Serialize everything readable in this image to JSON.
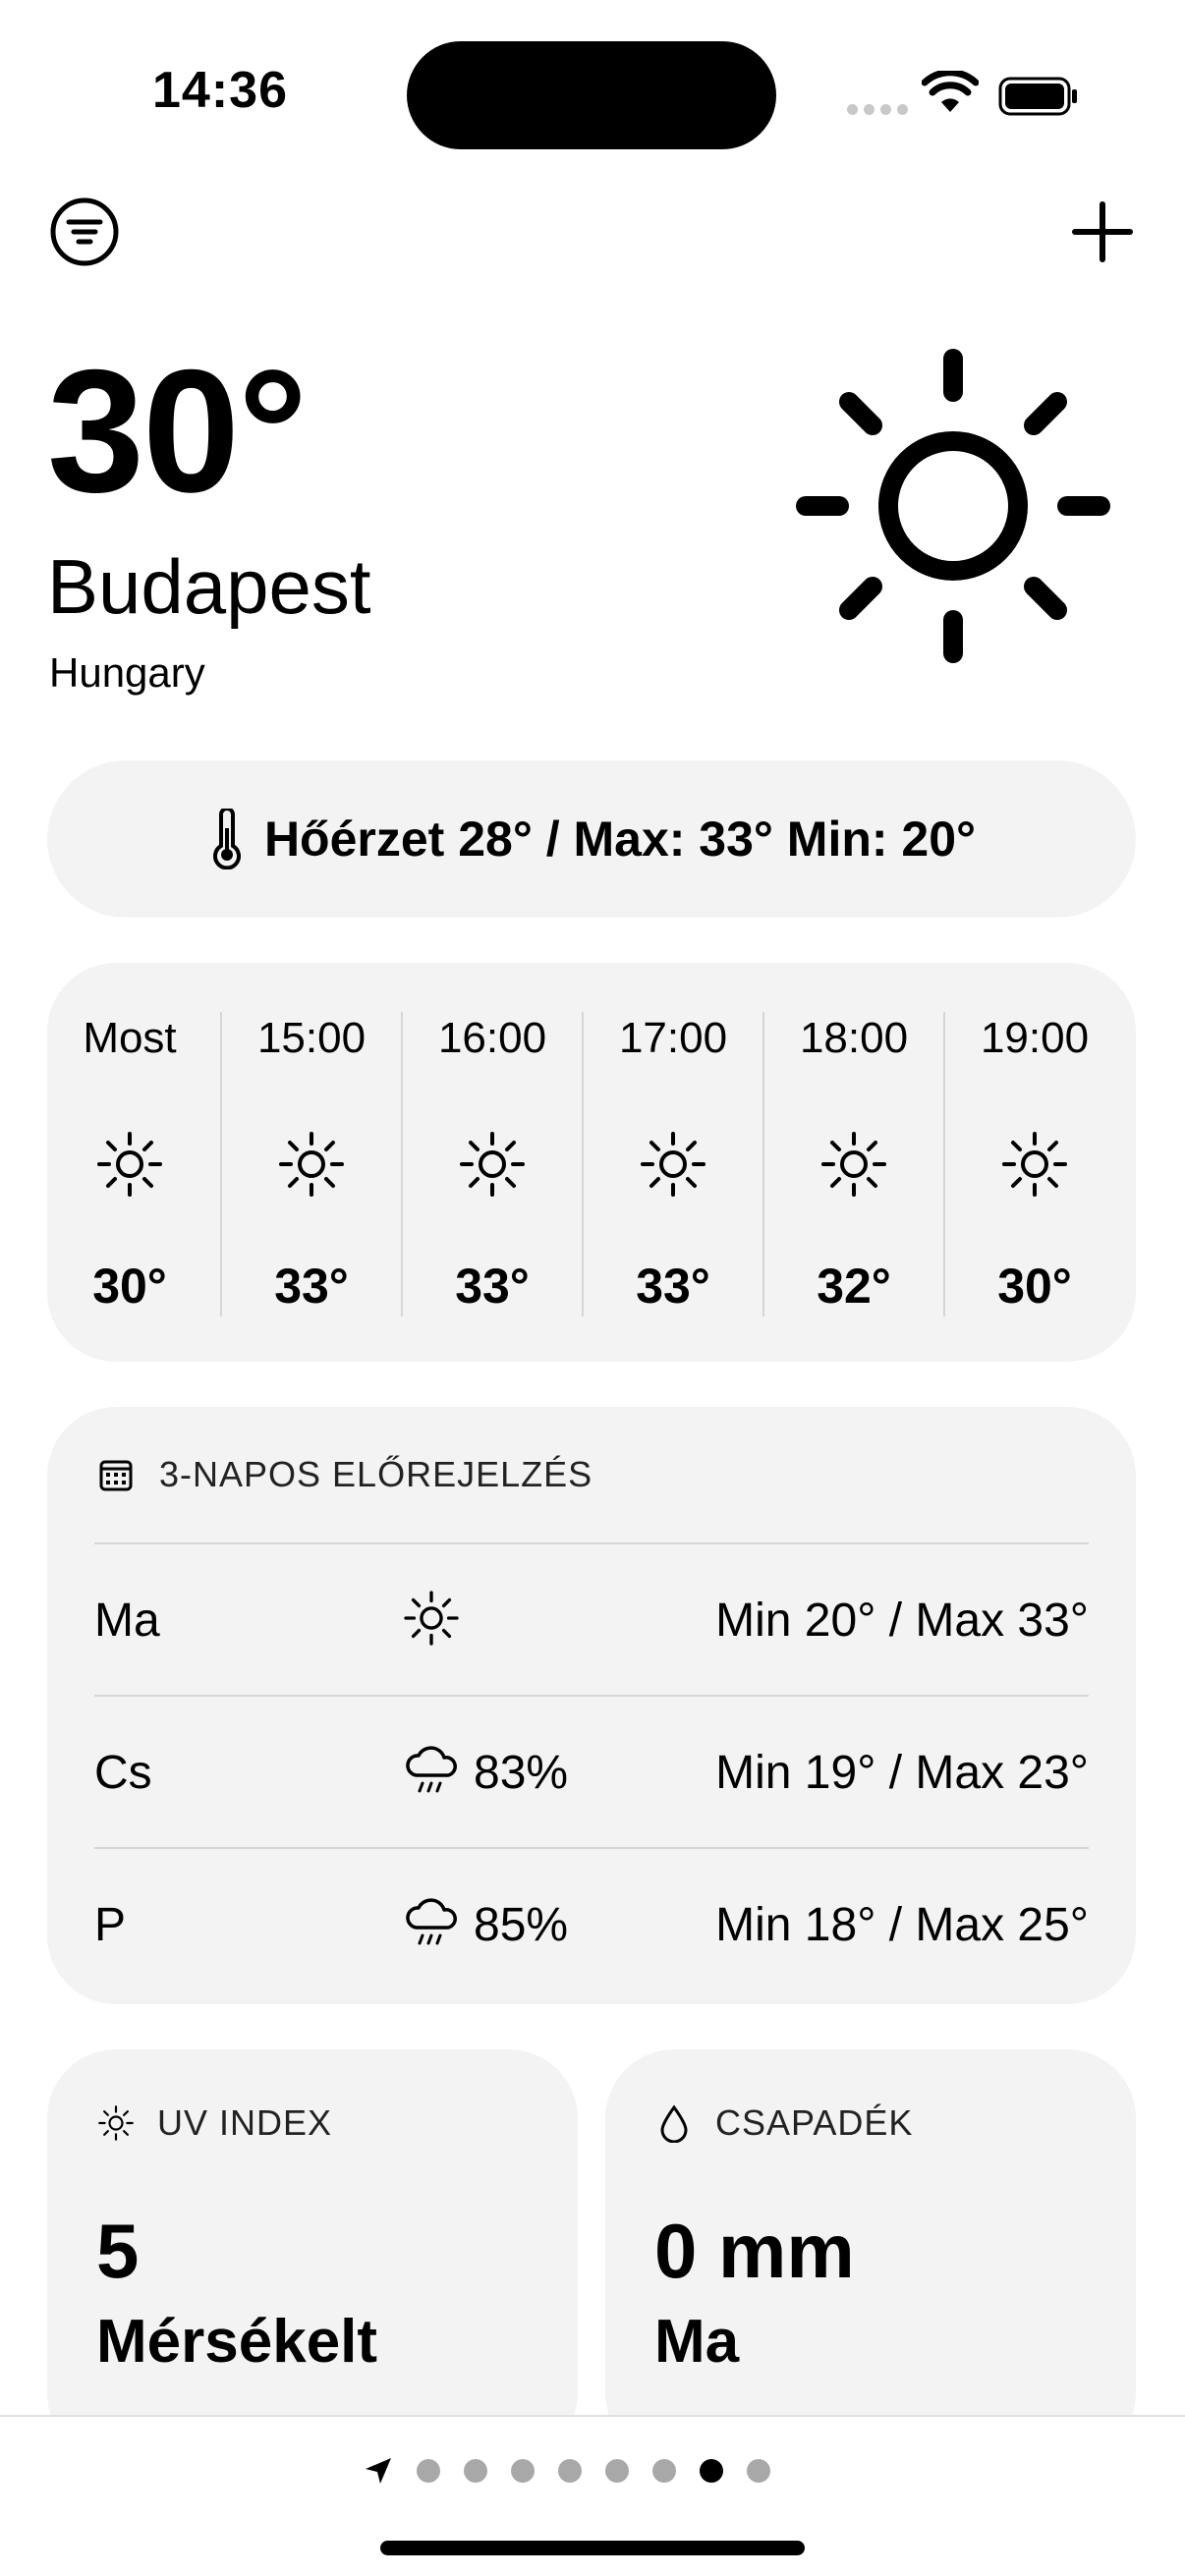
{
  "status_bar": {
    "time": "14:36"
  },
  "header": {
    "temperature": "30°",
    "city": "Budapest",
    "country": "Hungary",
    "condition_icon": "sun-icon"
  },
  "feels_like": {
    "text": "Hőérzet 28° / Max: 33° Min: 20°",
    "icon": "thermometer-icon"
  },
  "hourly": [
    {
      "time": "Most",
      "icon": "sun-icon",
      "temp": "30°"
    },
    {
      "time": "15:00",
      "icon": "sun-icon",
      "temp": "33°"
    },
    {
      "time": "16:00",
      "icon": "sun-icon",
      "temp": "33°"
    },
    {
      "time": "17:00",
      "icon": "sun-icon",
      "temp": "33°"
    },
    {
      "time": "18:00",
      "icon": "sun-icon",
      "temp": "32°"
    },
    {
      "time": "19:00",
      "icon": "sun-icon",
      "temp": "30°"
    }
  ],
  "forecast": {
    "title": "3-NAPOS ELŐREJELZÉS",
    "days": [
      {
        "day": "Ma",
        "icon": "sun-icon",
        "precip": "",
        "range": "Min 20° / Max 33°"
      },
      {
        "day": "Cs",
        "icon": "cloud-rain-icon",
        "precip": "83%",
        "range": "Min 19° / Max 23°"
      },
      {
        "day": "P",
        "icon": "cloud-rain-icon",
        "precip": "85%",
        "range": "Min 18° / Max 25°"
      }
    ]
  },
  "tiles": {
    "uv": {
      "title": "UV INDEX",
      "value": "5",
      "label": "Mérsékelt"
    },
    "precipitation": {
      "title": "CSAPADÉK",
      "value": "0 mm",
      "label": "Ma"
    }
  },
  "page_indicator": {
    "total_pages": 8,
    "active_index": 6
  },
  "colors": {
    "card_background": "#f3f3f3",
    "text": "#000000",
    "divider": "#d6d6d6"
  }
}
